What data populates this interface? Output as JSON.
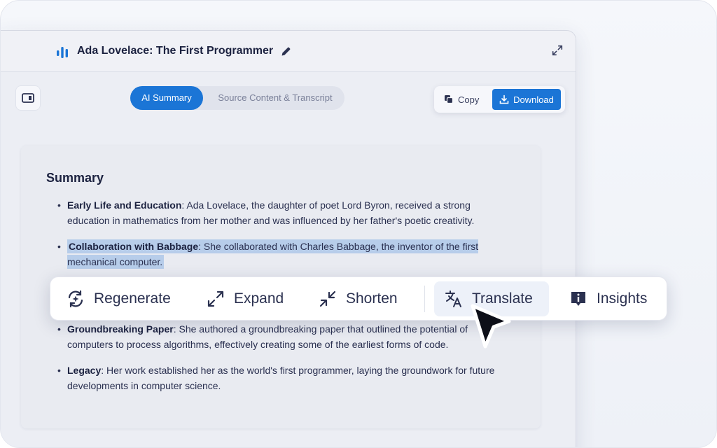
{
  "document": {
    "title": "Ada Lovelace: The First Programmer"
  },
  "tabs": {
    "active": "AI Summary",
    "inactive": "Source Content & Transcript"
  },
  "actions": {
    "copy_label": "Copy",
    "download_label": "Download"
  },
  "summary": {
    "heading": "Summary",
    "items": [
      {
        "label": "Early Life and Education",
        "text": ": Ada Lovelace, the daughter of poet Lord Byron, received a strong education in mathematics from her mother and was influenced by her father's poetic creativity."
      },
      {
        "label": "Collaboration with Babbage",
        "text": ": She collaborated with Charles Babbage, the inventor of the first mechanical computer."
      },
      {
        "label": "Groundbreaking Paper",
        "text": ": She authored a groundbreaking paper that outlined the potential of computers to process algorithms, effectively creating some of the earliest forms of code."
      },
      {
        "label": "Legacy",
        "text": ": Her work established her as the world's first programmer, laying the groundwork for future developments in computer science."
      }
    ]
  },
  "toolbar": {
    "regenerate": "Regenerate",
    "expand": "Expand",
    "shorten": "Shorten",
    "translate": "Translate",
    "insights": "Insights"
  },
  "colors": {
    "accent": "#1b75d6",
    "highlight": "#b7cdea",
    "text_dark": "#1c2240"
  },
  "icons": {
    "doc": "bar-chart-icon",
    "edit": "pencil-icon",
    "window_expand": "expand-arrows-icon",
    "panel": "sidebar-panel-icon",
    "copy": "copy-icon",
    "download": "download-icon",
    "regenerate": "regenerate-icon",
    "expand": "expand-icon",
    "shorten": "shorten-icon",
    "translate": "translate-icon",
    "insights": "info-badge-icon"
  }
}
